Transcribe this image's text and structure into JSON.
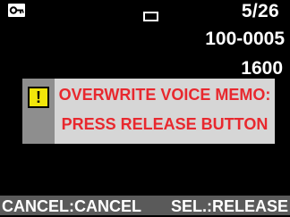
{
  "status": {
    "protect_icon": "key-protect-icon",
    "card_icon": "memory-card-icon",
    "frame_count": "5/26",
    "folder_file": "100-0005",
    "iso": "1600"
  },
  "dialog": {
    "icon": "warning-icon",
    "icon_glyph": "!",
    "line1": "OVERWRITE VOICE MEMO:",
    "line2": "PRESS RELEASE BUTTON",
    "text_color": "#e8282e",
    "icon_color": "#f2e60a"
  },
  "footer": {
    "cancel": "CANCEL:CANCEL",
    "release": "SEL.:RELEASE"
  }
}
